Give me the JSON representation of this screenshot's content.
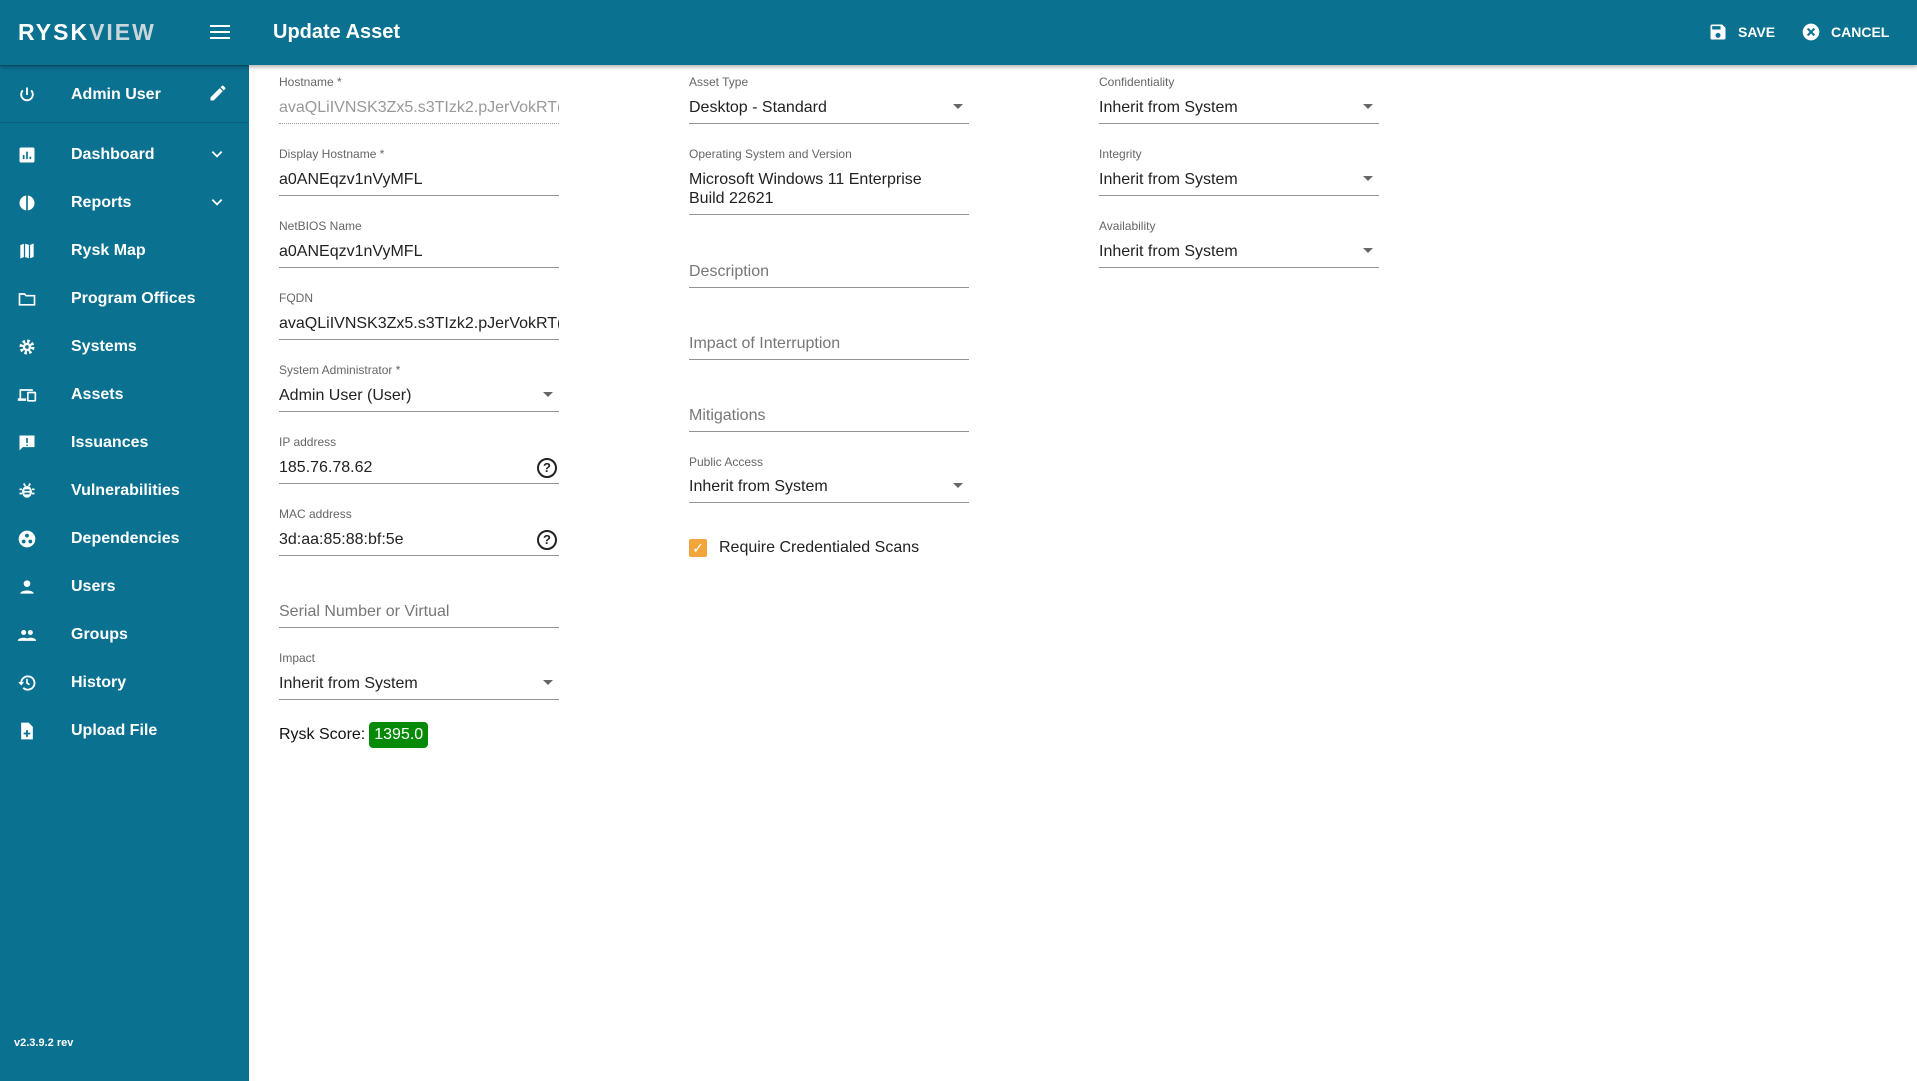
{
  "app": {
    "logo": "RYSKVIEW",
    "title": "Update Asset",
    "save": "SAVE",
    "cancel": "CANCEL",
    "version": "v2.3.9.2 rev"
  },
  "sidebar": {
    "user": "Admin User",
    "items": [
      {
        "label": "Dashboard",
        "icon": "bar-chart-icon",
        "expand": true
      },
      {
        "label": "Reports",
        "icon": "pie-chart-icon",
        "expand": true
      },
      {
        "label": "Rysk Map",
        "icon": "map-icon"
      },
      {
        "label": "Program Offices",
        "icon": "folder-icon"
      },
      {
        "label": "Systems",
        "icon": "gear-icon"
      },
      {
        "label": "Assets",
        "icon": "devices-icon"
      },
      {
        "label": "Issuances",
        "icon": "feedback-icon"
      },
      {
        "label": "Vulnerabilities",
        "icon": "bug-icon"
      },
      {
        "label": "Dependencies",
        "icon": "workspaces-icon"
      },
      {
        "label": "Users",
        "icon": "person-icon"
      },
      {
        "label": "Groups",
        "icon": "group-icon"
      },
      {
        "label": "History",
        "icon": "history-icon"
      },
      {
        "label": "Upload File",
        "icon": "upload-file-icon"
      }
    ]
  },
  "form": {
    "hostname": {
      "label": "Hostname *",
      "value": "avaQLiIVNSK3Zx5.s3TIzk2.pJerVokRT("
    },
    "display_hostname": {
      "label": "Display Hostname *",
      "value": "a0ANEqzv1nVyMFL"
    },
    "netbios": {
      "label": "NetBIOS Name",
      "value": "a0ANEqzv1nVyMFL"
    },
    "fqdn": {
      "label": "FQDN",
      "value": "avaQLiIVNSK3Zx5.s3TIzk2.pJerVokRT("
    },
    "sysadmin": {
      "label": "System Administrator *",
      "value": "Admin User (User)"
    },
    "ip": {
      "label": "IP address",
      "value": "185.76.78.62"
    },
    "mac": {
      "label": "MAC address",
      "value": "3d:aa:85:88:bf:5e"
    },
    "serial": {
      "placeholder": "Serial Number or Virtual"
    },
    "impact": {
      "label": "Impact",
      "value": "Inherit from System"
    },
    "score": {
      "label": "Rysk Score:",
      "value": "1395.0",
      "color": "#078a07"
    },
    "asset_type": {
      "label": "Asset Type",
      "value": "Desktop - Standard"
    },
    "os": {
      "label": "Operating System and Version",
      "line1": "Microsoft Windows 11 Enterprise",
      "line2": "Build 22621"
    },
    "description": {
      "placeholder": "Description"
    },
    "interruption": {
      "placeholder": "Impact of Interruption"
    },
    "mitigations": {
      "placeholder": "Mitigations"
    },
    "public_access": {
      "label": "Public Access",
      "value": "Inherit from System"
    },
    "cred_scans": {
      "label": "Require Credentialed Scans",
      "checked": true
    },
    "confidentiality": {
      "label": "Confidentiality",
      "value": "Inherit from System"
    },
    "integrity": {
      "label": "Integrity",
      "value": "Inherit from System"
    },
    "availability": {
      "label": "Availability",
      "value": "Inherit from System"
    }
  }
}
